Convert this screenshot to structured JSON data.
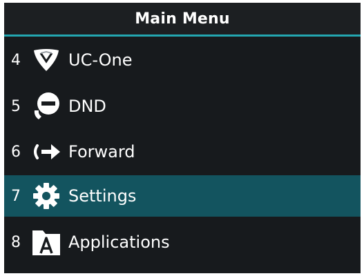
{
  "header": {
    "title": "Main Menu"
  },
  "menu": {
    "items": [
      {
        "number": "4",
        "label": "UC-One",
        "icon": "uc-one-icon"
      },
      {
        "number": "5",
        "label": "DND",
        "icon": "dnd-icon"
      },
      {
        "number": "6",
        "label": "Forward",
        "icon": "forward-icon"
      },
      {
        "number": "7",
        "label": "Settings",
        "icon": "settings-icon",
        "selected": true
      },
      {
        "number": "8",
        "label": "Applications",
        "icon": "applications-icon"
      }
    ]
  },
  "colors": {
    "background": "#171a1d",
    "accent": "#23a7b1",
    "selected_row": "#13545f",
    "text": "#ffffff"
  }
}
